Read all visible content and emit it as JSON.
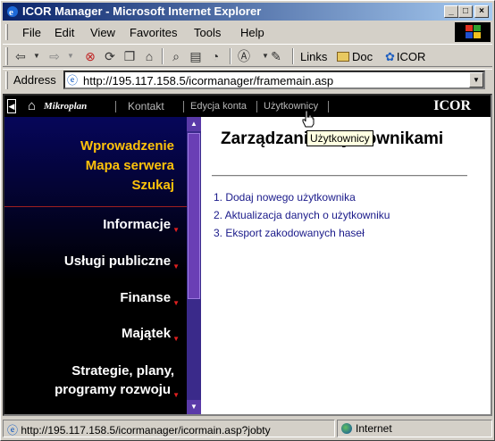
{
  "window": {
    "title": "ICOR Manager - Microsoft Internet Explorer"
  },
  "menu": {
    "items": [
      "File",
      "Edit",
      "View",
      "Favorites",
      "Tools",
      "Help"
    ]
  },
  "toolbar": {
    "links_label": "Links",
    "links": [
      {
        "label": "Doc",
        "icon": "folder-icon"
      },
      {
        "label": "ICOR",
        "icon": "link-icon"
      }
    ]
  },
  "address": {
    "label": "Address",
    "url": "http://195.117.158.5/icormanager/framemain.asp"
  },
  "topnav": {
    "brand": "Mikroplan",
    "links": [
      "Kontakt",
      "Edycja konta",
      "Użytkownicy"
    ],
    "logo_text": "ICOR"
  },
  "sidebar": {
    "top_links": [
      "Wprowadzenie",
      "Mapa serwera",
      "Szukaj"
    ],
    "items": [
      "Informacje",
      "Usługi publiczne",
      "Finanse",
      "Majątek",
      "Strategie, plany,",
      "programy rozwoju"
    ]
  },
  "main": {
    "heading": "Zarządzanie użytkownikami",
    "list": [
      "1. Dodaj nowego użytkownika",
      "2. Aktualizacja danych o użytkowniku",
      "3. Eksport zakodowanych haseł"
    ]
  },
  "tooltip": "Użytkownicy",
  "status": {
    "url": "http://195.117.158.5/icormanager/icormain.asp?jobty",
    "zone": "Internet"
  },
  "colors": {
    "sidebar_gold": "#ffc20a",
    "link_blue": "#1a1a8a",
    "titlebar": "#0a246a"
  }
}
